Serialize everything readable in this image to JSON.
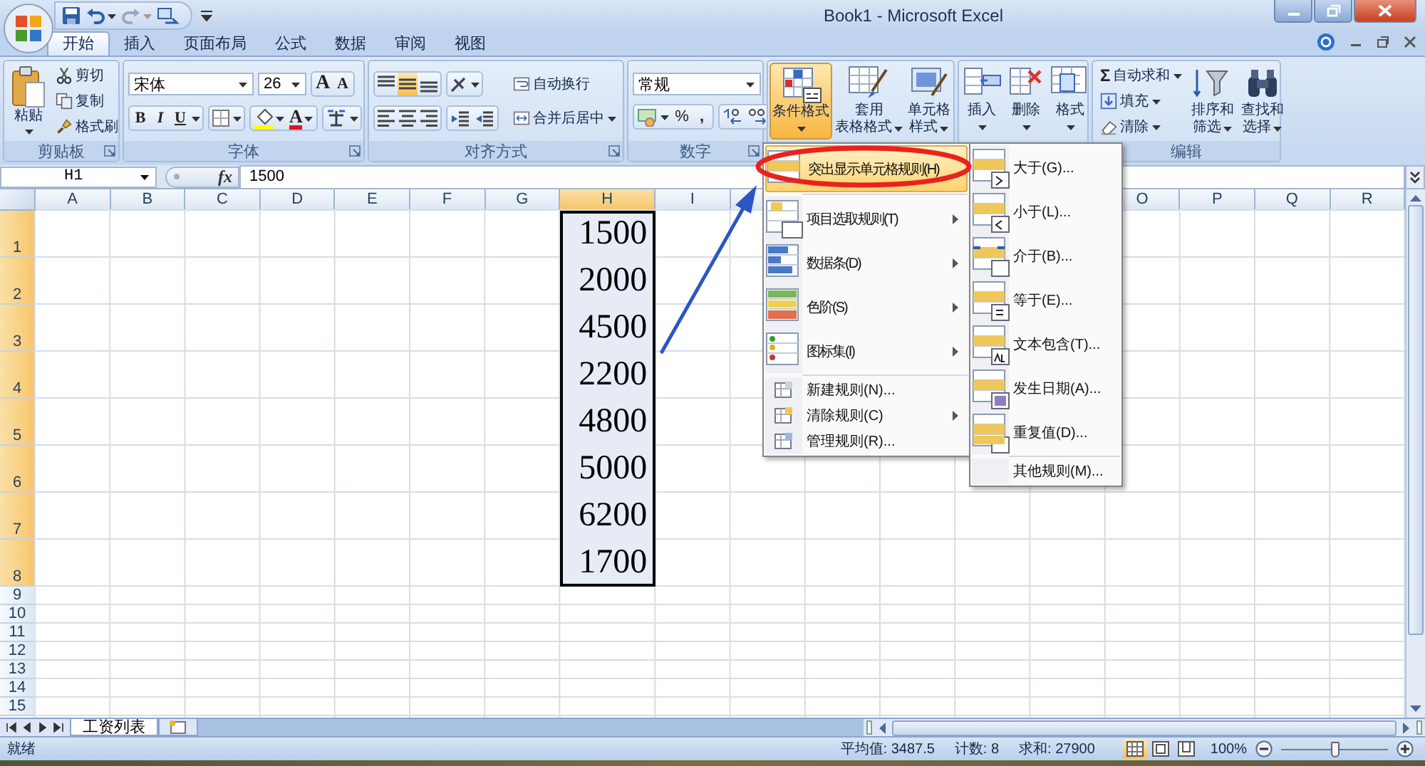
{
  "title_bar": {
    "title": "Book1 - Microsoft Excel"
  },
  "ribbon_tabs": [
    {
      "label": "开始",
      "selected": true
    },
    {
      "label": "插入",
      "selected": false
    },
    {
      "label": "页面布局",
      "selected": false
    },
    {
      "label": "公式",
      "selected": false
    },
    {
      "label": "数据",
      "selected": false
    },
    {
      "label": "审阅",
      "selected": false
    },
    {
      "label": "视图",
      "selected": false
    }
  ],
  "clipboard": {
    "label": "剪贴板",
    "paste": "粘贴",
    "cut": "剪切",
    "copy": "复制",
    "format_painter": "格式刷"
  },
  "font": {
    "label": "字体",
    "font_name": "宋体",
    "font_size": "26",
    "grow": "A",
    "shrink": "A",
    "bold": "B",
    "italic": "I",
    "underline": "U",
    "font_color": "A"
  },
  "alignment": {
    "label": "对齐方式",
    "vertical": [
      {
        "selected": false
      },
      {
        "selected": true
      },
      {
        "selected": false
      }
    ],
    "wrap_text": "自动换行",
    "merge_center": "合并后居中"
  },
  "number": {
    "label": "数字",
    "format": "常规",
    "percent": "%",
    "comma": ","
  },
  "styles": {
    "conditional_formatting": {
      "label": "条件格式",
      "open": true
    },
    "table_format": [
      "套用",
      "表格格式"
    ],
    "cell_styles": [
      "单元格",
      "样式"
    ]
  },
  "cells": {
    "insert": "插入",
    "delete": "删除",
    "format": "格式"
  },
  "editing": {
    "label": "编辑",
    "sigma": "Σ",
    "autosum": "自动求和",
    "fill": "填充",
    "clear": "清除",
    "sort_filter": [
      "排序和",
      "筛选"
    ],
    "find_select": [
      "查找和",
      "选择"
    ]
  },
  "formula_bar": {
    "name_box": "H1",
    "fx": "fx",
    "formula": "1500"
  },
  "sheet": {
    "columns": [
      {
        "label": "A",
        "selected": false
      },
      {
        "label": "B",
        "selected": false
      },
      {
        "label": "C",
        "selected": false
      },
      {
        "label": "D",
        "selected": false
      },
      {
        "label": "E",
        "selected": false
      },
      {
        "label": "F",
        "selected": false
      },
      {
        "label": "G",
        "selected": false
      },
      {
        "label": "H",
        "selected": true
      },
      {
        "label": "I",
        "selected": false
      },
      {
        "selected": false
      },
      {},
      {},
      {},
      {},
      {
        "label": "O",
        "selected": false
      },
      {
        "label": "P",
        "selected": false
      },
      {
        "label": "Q",
        "selected": false
      },
      {
        "label": "R",
        "selected": false
      }
    ],
    "rows": [
      {
        "number": "1",
        "selected": true,
        "h": "1500"
      },
      {
        "number": "2",
        "selected": true,
        "h": "2000"
      },
      {
        "number": "3",
        "selected": true,
        "h": "4500"
      },
      {
        "number": "4",
        "selected": true,
        "h": "2200"
      },
      {
        "number": "5",
        "selected": true,
        "h": "4800"
      },
      {
        "number": "6",
        "selected": true,
        "h": "5000"
      },
      {
        "number": "7",
        "selected": true,
        "h": "6200"
      },
      {
        "number": "8",
        "selected": true,
        "h": "1700"
      },
      {
        "number": "9",
        "selected": false
      },
      {
        "number": "10",
        "selected": false
      },
      {
        "number": "11",
        "selected": false
      },
      {
        "number": "12",
        "selected": false
      },
      {
        "number": "13",
        "selected": false
      },
      {
        "number": "14",
        "selected": false
      },
      {
        "number": "15",
        "selected": false
      }
    ]
  },
  "conditional_menu": {
    "items": [
      {
        "label": "突出显示单元格规则(H)",
        "kind": "large",
        "selected": true
      },
      {
        "label": "项目选取规则(T)",
        "kind": "large",
        "has_submenu": true,
        "selected": false
      },
      {
        "label": "数据条(D)",
        "kind": "large",
        "has_submenu": true,
        "selected": false
      },
      {
        "label": "色阶(S)",
        "kind": "large",
        "has_submenu": true,
        "selected": false
      },
      {
        "label": "图标集(I)",
        "kind": "large",
        "has_submenu": true,
        "selected": false
      },
      {
        "label": "新建规则(N)...",
        "kind": "small",
        "has_submenu": false,
        "selected": false
      },
      {
        "label": "清除规则(C)",
        "kind": "small",
        "has_submenu": true,
        "selected": false
      },
      {
        "label": "管理规则(R)...",
        "kind": "small",
        "has_submenu": false,
        "selected": false
      }
    ]
  },
  "highlight_submenu": {
    "items": [
      {
        "label": "大于(G)...",
        "kind": "large"
      },
      {
        "label": "小于(L)...",
        "kind": "large"
      },
      {
        "label": "介于(B)...",
        "kind": "large"
      },
      {
        "label": "等于(E)...",
        "kind": "large"
      },
      {
        "label": "文本包含(T)...",
        "kind": "large"
      },
      {
        "label": "发生日期(A)...",
        "kind": "large"
      },
      {
        "label": "重复值(D)...",
        "kind": "large"
      },
      {
        "label": "其他规则(M)...",
        "kind": "small"
      }
    ]
  },
  "sheet_tabs": [
    {
      "label": "工资列表",
      "selected": true
    }
  ],
  "status_bar": {
    "ready": "就绪",
    "average": "平均值: 3487.5",
    "count": "计数: 8",
    "sum": "求和: 27900",
    "views": [
      {
        "selected": true
      },
      {
        "selected": false
      },
      {
        "selected": false
      }
    ],
    "zoom": "100%",
    "zoom_slider": {
      "level": 0.5
    }
  }
}
